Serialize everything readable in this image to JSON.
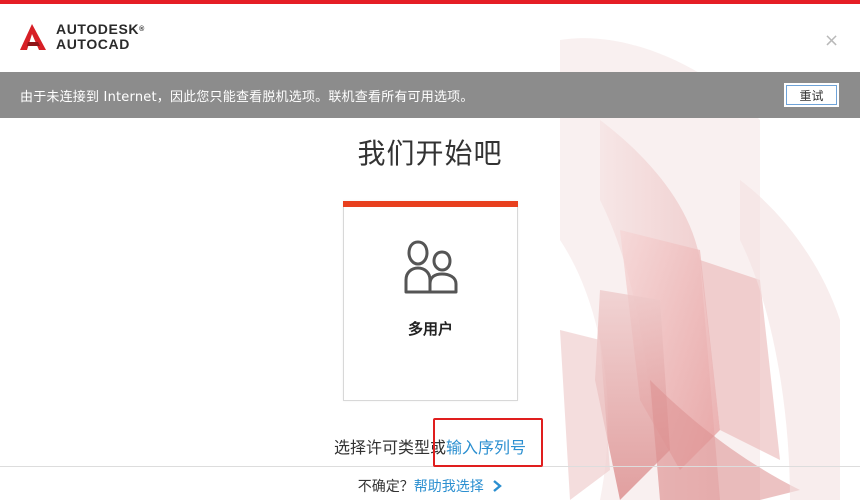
{
  "brand": {
    "line1": "AUTODESK",
    "line2": "AUTOCAD",
    "reg_mark": "®",
    "accent_color": "#e51e25"
  },
  "window": {
    "close_glyph": "×"
  },
  "banner": {
    "message": "由于未连接到 Internet，因此您只能查看脱机选项。联机查看所有可用选项。",
    "retry_label": "重试",
    "background": "#8c8c8c"
  },
  "main": {
    "title": "我们开始吧",
    "cards": [
      {
        "label": "多用户",
        "icon": "multi-user-icon",
        "accent": "#e8401e"
      }
    ],
    "license_prompt": "选择许可类型或",
    "serial_link": "输入序列号",
    "link_color": "#2b8fd0"
  },
  "footer": {
    "unsure_label": "不确定？",
    "help_link": "帮助我选择",
    "help_icon": "chevron-right-icon"
  }
}
